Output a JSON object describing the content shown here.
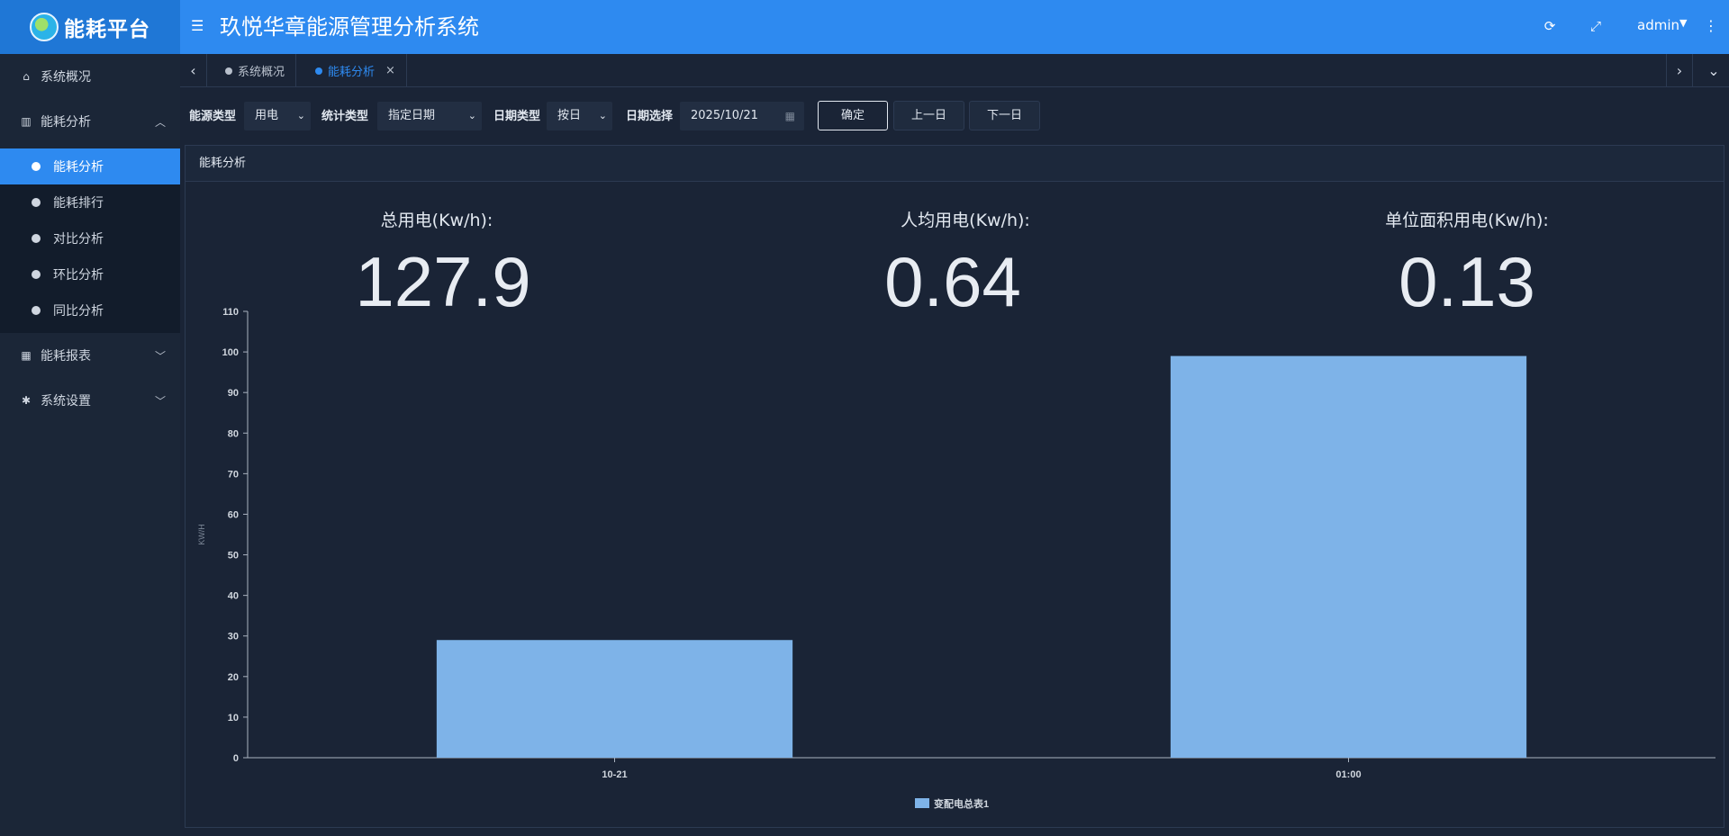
{
  "app": {
    "logo_text": "能耗平台",
    "title": "玖悦华章能源管理分析系统",
    "user": "admin"
  },
  "sidebar": {
    "items": [
      {
        "label": "系统概况",
        "icon": "home-icon"
      },
      {
        "label": "能耗分析",
        "icon": "bar-chart-icon",
        "expanded": true
      },
      {
        "label": "能耗报表",
        "icon": "table-icon"
      },
      {
        "label": "系统设置",
        "icon": "gear-icon"
      }
    ],
    "sub_items": [
      {
        "label": "能耗分析",
        "active": true
      },
      {
        "label": "能耗排行"
      },
      {
        "label": "对比分析"
      },
      {
        "label": "环比分析"
      },
      {
        "label": "同比分析"
      }
    ]
  },
  "tabs": [
    {
      "label": "系统概况",
      "active": false
    },
    {
      "label": "能耗分析",
      "active": true,
      "close": "×"
    }
  ],
  "filters": {
    "energy_type_label": "能源类型",
    "energy_type_value": "用电",
    "stat_type_label": "统计类型",
    "stat_type_value": "指定日期",
    "date_type_label": "日期类型",
    "date_type_value": "按日",
    "date_select_label": "日期选择",
    "date_value": "2025/10/21",
    "confirm": "确定",
    "prev_day": "上一日",
    "next_day": "下一日"
  },
  "panel": {
    "title": "能耗分析"
  },
  "stats": [
    {
      "label": "总用电(Kw/h):",
      "value": "127.9"
    },
    {
      "label": "人均用电(Kw/h):",
      "value": "0.64"
    },
    {
      "label": "单位面积用电(Kw/h):",
      "value": "0.13"
    }
  ],
  "chart_data": {
    "type": "bar",
    "categories": [
      "10-21",
      "01:00"
    ],
    "series": [
      {
        "name": "变配电总表1",
        "values": [
          29,
          99
        ],
        "color": "#7eb3e8"
      }
    ],
    "ylabel": "KW/H",
    "ylim": [
      0,
      110
    ],
    "yticks": [
      "0",
      "10",
      "20",
      "30",
      "40",
      "50",
      "60",
      "70",
      "80",
      "90",
      "100",
      "110"
    ],
    "grid": false,
    "legend": "bottom-center"
  }
}
